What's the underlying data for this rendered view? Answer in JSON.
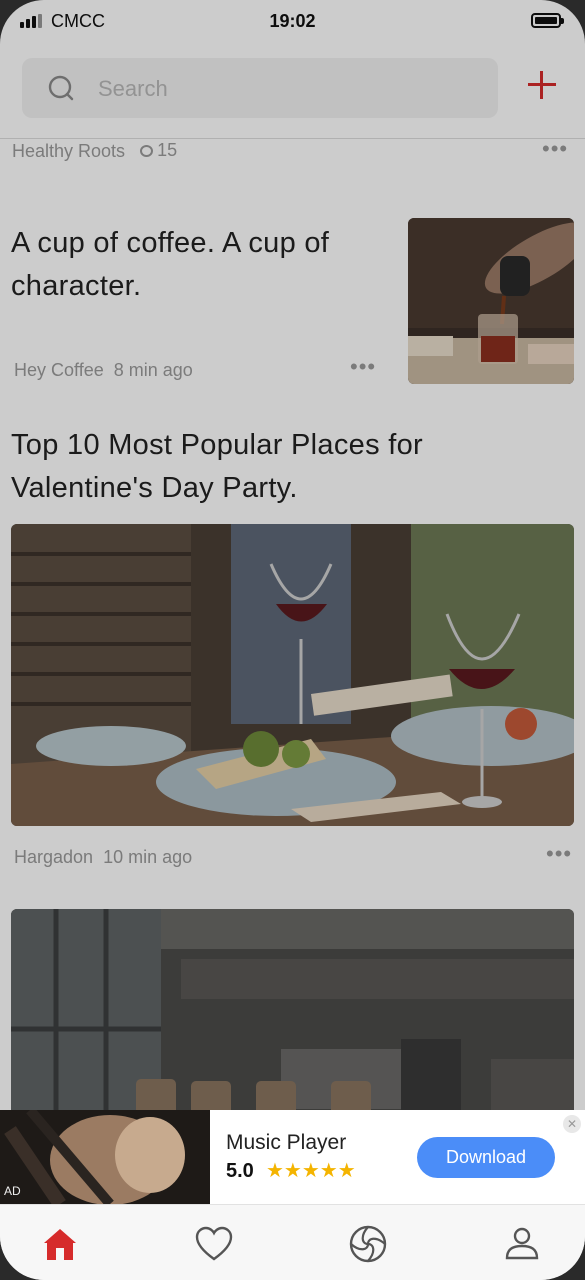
{
  "status_bar": {
    "carrier": "CMCC",
    "time": "19:02"
  },
  "search": {
    "placeholder": "Search"
  },
  "feed": {
    "prev_item": {
      "author": "Healthy Roots",
      "comments": "15"
    },
    "articles": [
      {
        "title": "A cup of coffee. A cup of character.",
        "author": "Hey Coffee",
        "time": "8 min ago"
      },
      {
        "title": "Top 10 Most Popular Places for Valentine's Day Party.",
        "author": "Hargadon",
        "time": "10 min ago"
      }
    ]
  },
  "ad": {
    "tag": "AD",
    "app_name": "Music Player",
    "rating": "5.0",
    "stars": "★★★★★",
    "cta": "Download"
  },
  "tabs": [
    {
      "icon": "home-icon",
      "active": true
    },
    {
      "icon": "heart-icon",
      "active": false
    },
    {
      "icon": "aperture-icon",
      "active": false
    },
    {
      "icon": "user-icon",
      "active": false
    }
  ],
  "colors": {
    "accent": "#d62b2b",
    "download": "#4b8df8",
    "star": "#f4b400"
  }
}
